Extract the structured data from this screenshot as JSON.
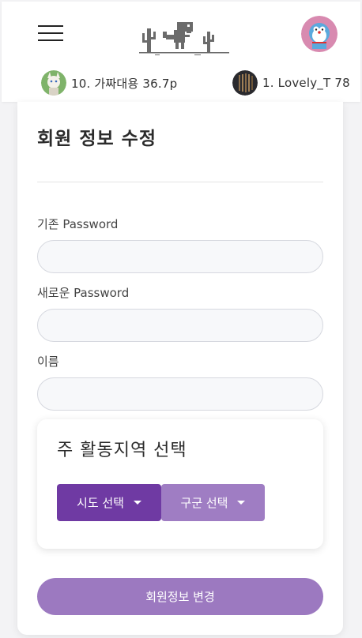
{
  "header": {
    "ranking": [
      {
        "text": "10. 가짜대용 36.7p"
      },
      {
        "text": "1. Lovely_T 78"
      }
    ]
  },
  "form": {
    "title": "회원 정보 수정",
    "fields": [
      {
        "label": "기존 Password",
        "value": "",
        "placeholder": ""
      },
      {
        "label": "새로운 Password",
        "value": "",
        "placeholder": ""
      },
      {
        "label": "이름",
        "value": "",
        "placeholder": ""
      }
    ]
  },
  "region": {
    "title": "주 활동지역 선택",
    "sido_label": "시도 선택",
    "gugun_label": "구군 선택"
  },
  "submit_label": "회원정보 변경",
  "colors": {
    "primary_purple": "#6f3aa3",
    "light_purple": "#9f7dc3",
    "submit_purple": "#9c79c0",
    "dino_gray": "#6b6b6b"
  },
  "icons": {
    "menu": "hamburger-menu-icon",
    "logo": "dino-cactus-logo",
    "caret": "caret-down-icon"
  }
}
